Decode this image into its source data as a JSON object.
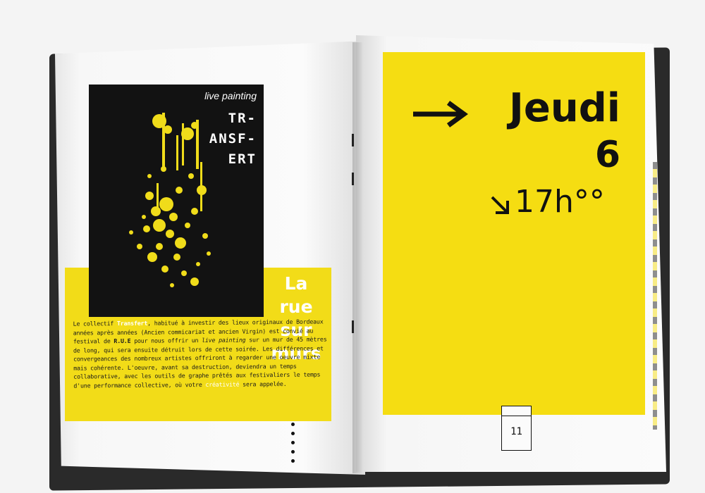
{
  "left_page": {
    "poster": {
      "subtitle": "live painting",
      "title_lines": [
        "TR-",
        "ANSF-",
        "ERT"
      ]
    },
    "heading_lines": [
      "La",
      "rue",
      "sur",
      "murs"
    ],
    "body": {
      "p1": "Le collectif ",
      "transfert": "Transfert",
      "p2": ", habitué à investir des lieux originaux de Bordeaux années après années (Ancien commicariat et ancien Virgin) est convié au festival de ",
      "rue": "R.U.E",
      "p3": " pour nous offrir un ",
      "live": "live painting",
      "p4": " sur un mur de 45 mètres de long, qui sera ensuite détruit lors de cette soirée. Les différences et convergeances des nombreux artistes offriront à regarder une oeuvre mixte mais cohérente. L'oeuvre, avant sa destruction, deviendra un temps collaborative, avec les outils de graphe prêtés aux festivaliers le temps d'une performance collective, où votre ",
      "creativite": "créativité",
      "p5": " sera appelée."
    }
  },
  "right_page": {
    "day": "Jeudi",
    "date": "6",
    "time": "17h°°",
    "page_number": "11"
  },
  "colors": {
    "yellow": "#f5dd12",
    "black": "#121212"
  }
}
